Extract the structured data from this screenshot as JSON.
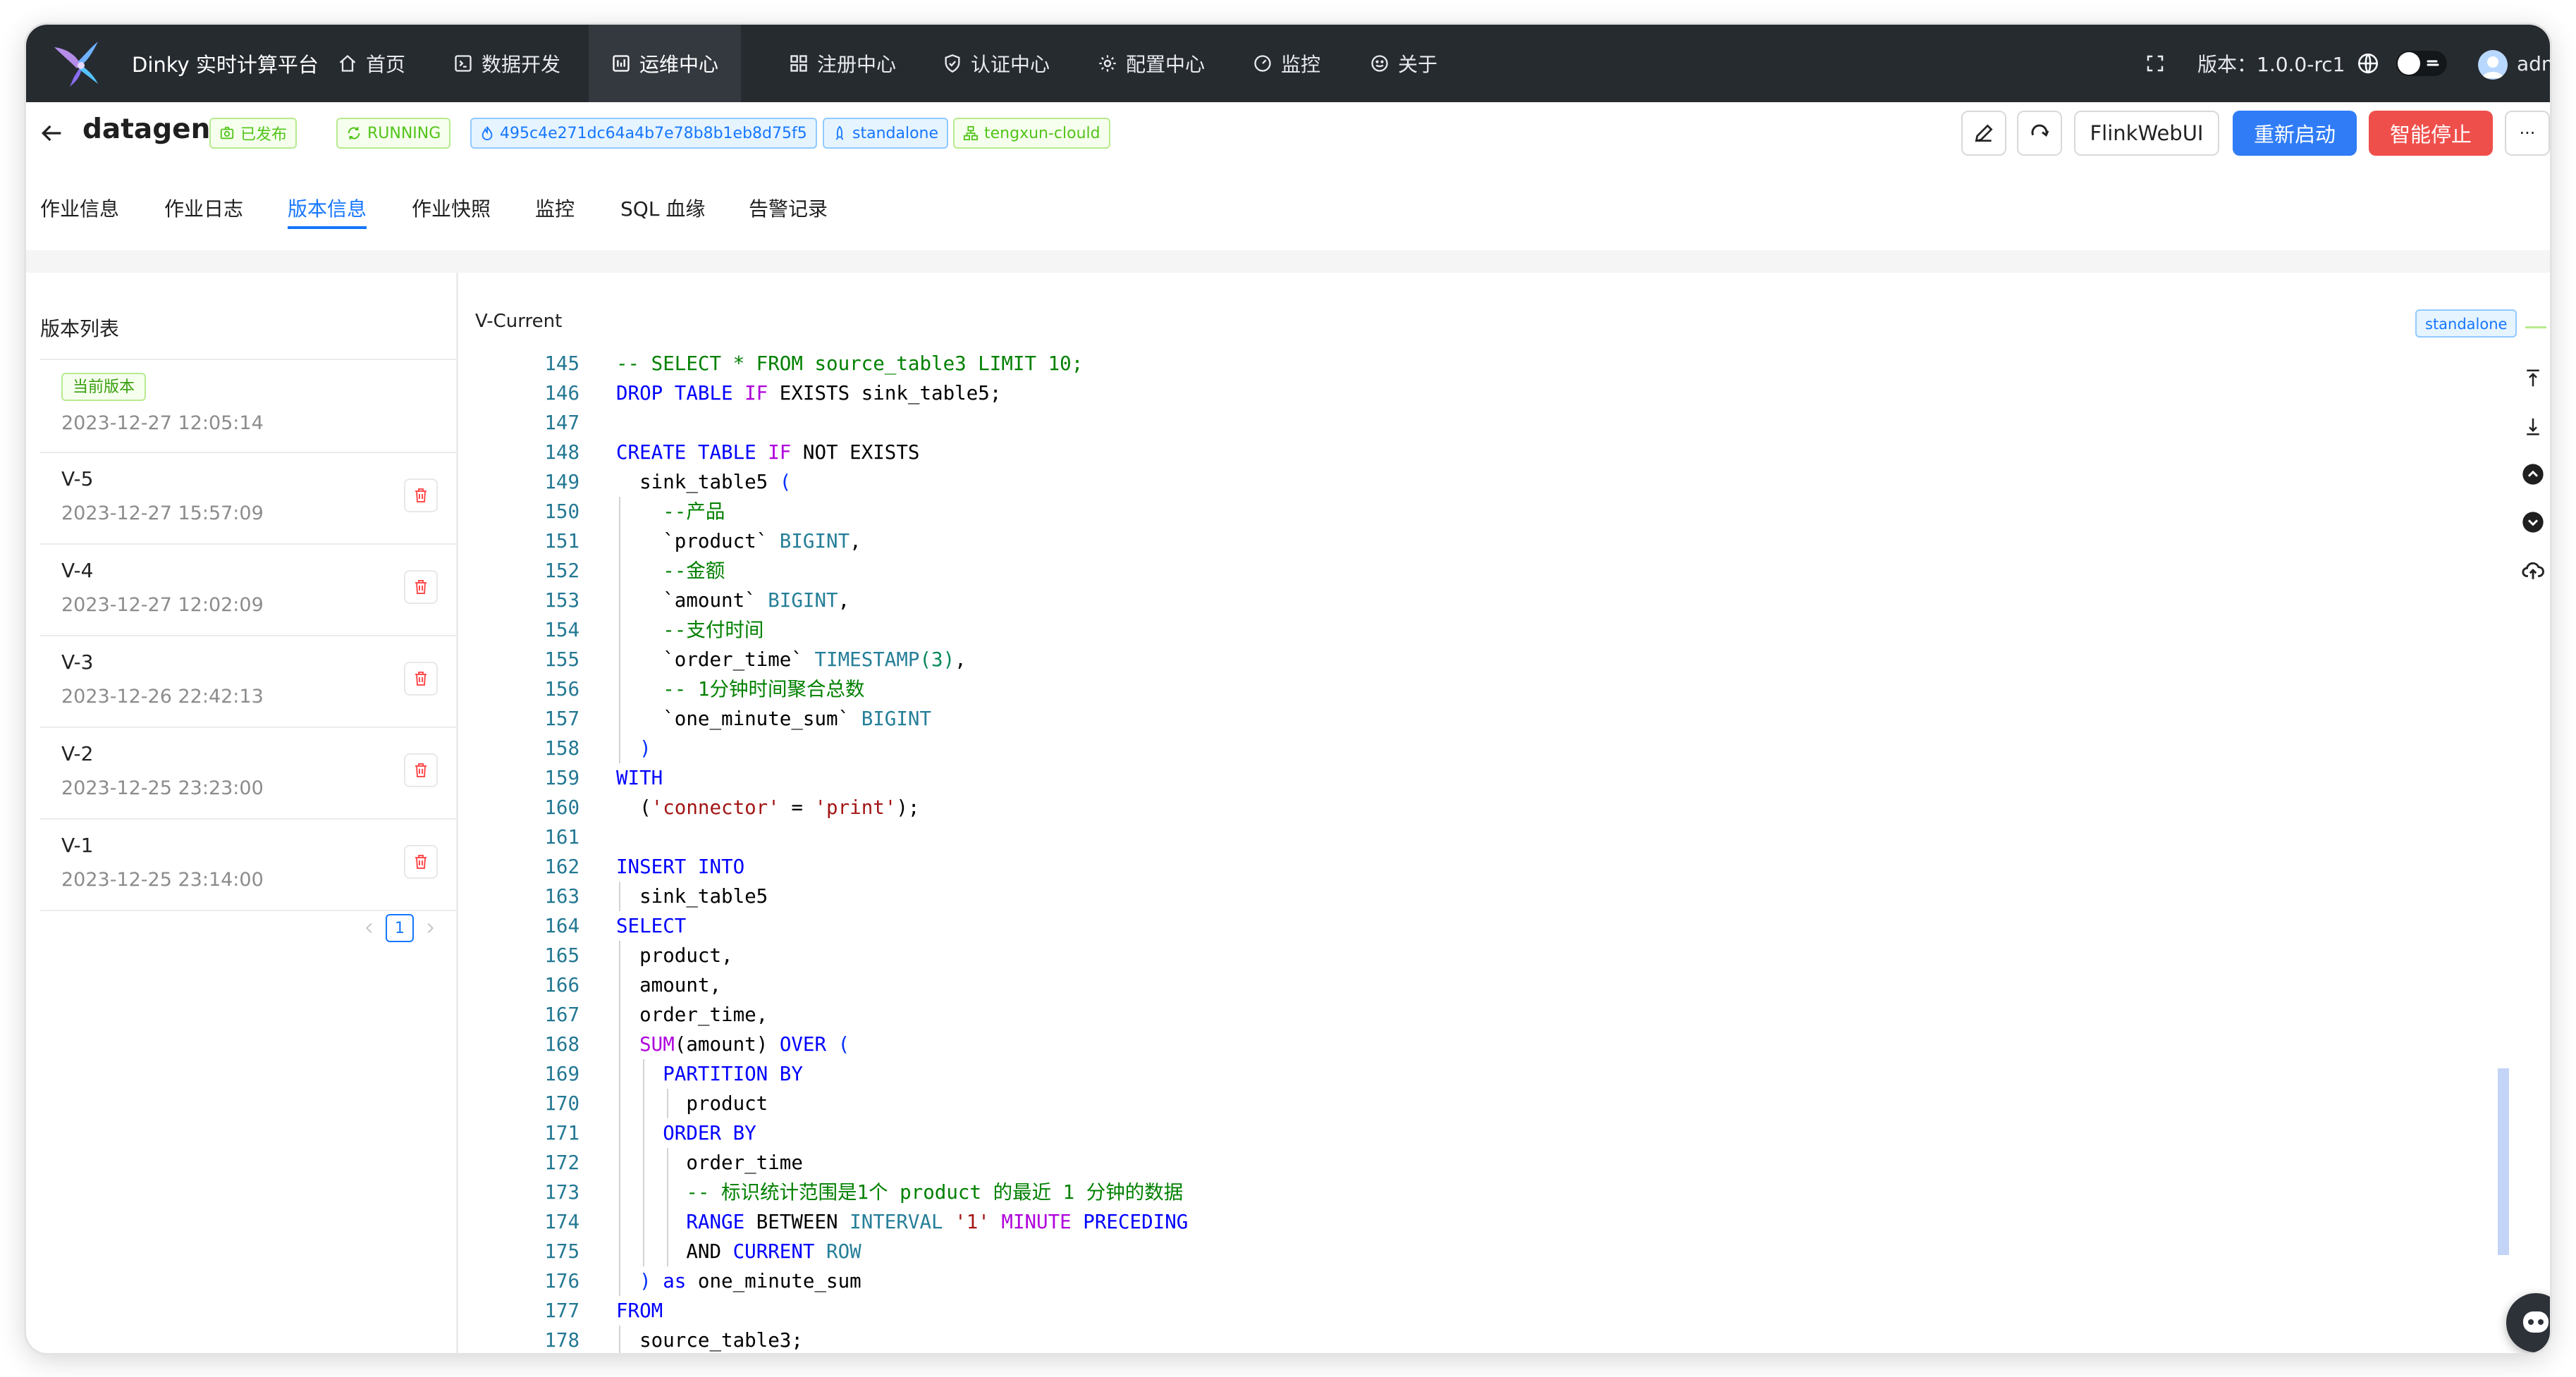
{
  "topbar": {
    "app_title": "Dinky 实时计算平台",
    "nav": [
      {
        "label": "首页",
        "icon": "home-icon",
        "active": false
      },
      {
        "label": "数据开发",
        "icon": "code-icon",
        "active": false
      },
      {
        "label": "运维中心",
        "icon": "dashboard-icon",
        "active": true
      },
      {
        "label": "注册中心",
        "icon": "grid-icon",
        "active": false
      },
      {
        "label": "认证中心",
        "icon": "shield-icon",
        "active": false
      },
      {
        "label": "配置中心",
        "icon": "gear-icon",
        "active": false
      },
      {
        "label": "监控",
        "icon": "gauge-icon",
        "active": false
      },
      {
        "label": "关于",
        "icon": "smile-icon",
        "active": false
      }
    ],
    "version_text": "版本：1.0.0-rc1",
    "user_name": "admin",
    "colors": {
      "background": "#262b30",
      "active_background": "#34393f"
    }
  },
  "job": {
    "name": "datagen",
    "status_published": "已发布",
    "status_running": "RUNNING",
    "job_id": "495c4e271dc64a4b7e78b8b1eb8d75f5",
    "cluster_type": "standalone",
    "cluster_name": "tengxun-clould",
    "buttons": {
      "flink_web_ui": "FlinkWebUI",
      "restart": "重新启动",
      "smart_stop": "智能停止",
      "more": "···"
    },
    "colors": {
      "restart": "#2f7cf6",
      "smart_stop": "#ef4f4b",
      "success": "#52c41a",
      "link": "#1677ff"
    }
  },
  "tabs": [
    {
      "label": "作业信息",
      "active": false
    },
    {
      "label": "作业日志",
      "active": false
    },
    {
      "label": "版本信息",
      "active": true
    },
    {
      "label": "作业快照",
      "active": false
    },
    {
      "label": "监控",
      "active": false
    },
    {
      "label": "SQL 血缘",
      "active": false
    },
    {
      "label": "告警记录",
      "active": false
    }
  ],
  "version_list": {
    "title": "版本列表",
    "current_badge": "当前版本",
    "current_time": "2023-12-27 12:05:14",
    "items": [
      {
        "name": "V-5",
        "time": "2023-12-27 15:57:09"
      },
      {
        "name": "V-4",
        "time": "2023-12-27 12:02:09"
      },
      {
        "name": "V-3",
        "time": "2023-12-26 22:42:13"
      },
      {
        "name": "V-2",
        "time": "2023-12-25 23:23:00"
      },
      {
        "name": "V-1",
        "time": "2023-12-25 23:14:00"
      }
    ],
    "pagination": {
      "current_page": "1"
    }
  },
  "editor": {
    "title": "V-Current",
    "cluster_badge": "standalone",
    "scroll_position": 0.88,
    "first_line_number": 145,
    "lines": [
      [
        [
          "-- SELECT * FROM source_table3 LIMIT 10;",
          "c"
        ]
      ],
      [
        [
          "DROP TABLE ",
          "k"
        ],
        [
          "IF",
          "f"
        ],
        [
          " EXISTS sink_table5;",
          "p"
        ]
      ],
      [],
      [
        [
          "CREATE TABLE ",
          "k"
        ],
        [
          "IF",
          "f"
        ],
        [
          " NOT EXISTS",
          "p"
        ]
      ],
      [
        [
          "  sink_table5 ",
          "p"
        ],
        [
          "(",
          "b"
        ]
      ],
      [
        [
          "    --产品",
          "c"
        ]
      ],
      [
        [
          "    `product` ",
          "p"
        ],
        [
          "BIGINT",
          "y"
        ],
        [
          ",",
          "p"
        ]
      ],
      [
        [
          "    --金额",
          "c"
        ]
      ],
      [
        [
          "    `amount` ",
          "p"
        ],
        [
          "BIGINT",
          "y"
        ],
        [
          ",",
          "p"
        ]
      ],
      [
        [
          "    --支付时间",
          "c"
        ]
      ],
      [
        [
          "    `order_time` ",
          "p"
        ],
        [
          "TIMESTAMP",
          "y"
        ],
        [
          "(3)",
          "d"
        ],
        [
          ",",
          "p"
        ]
      ],
      [
        [
          "    -- 1分钟时间聚合总数",
          "c"
        ]
      ],
      [
        [
          "    `one_minute_sum` ",
          "p"
        ],
        [
          "BIGINT",
          "y"
        ]
      ],
      [
        [
          "  ",
          "p"
        ],
        [
          ")",
          "b"
        ]
      ],
      [
        [
          "WITH",
          "k"
        ]
      ],
      [
        [
          "  (",
          "p"
        ],
        [
          "'connector'",
          "s"
        ],
        [
          " = ",
          "p"
        ],
        [
          "'print'",
          "s"
        ],
        [
          ");",
          "p"
        ]
      ],
      [],
      [
        [
          "INSERT INTO",
          "k"
        ]
      ],
      [
        [
          "  sink_table5",
          "p"
        ]
      ],
      [
        [
          "SELECT",
          "k"
        ]
      ],
      [
        [
          "  product,",
          "p"
        ]
      ],
      [
        [
          "  amount,",
          "p"
        ]
      ],
      [
        [
          "  order_time,",
          "p"
        ]
      ],
      [
        [
          "  ",
          "p"
        ],
        [
          "SUM",
          "f"
        ],
        [
          "(amount) ",
          "p"
        ],
        [
          "OVER",
          "k"
        ],
        [
          " (",
          "b"
        ]
      ],
      [
        [
          "    PARTITION BY",
          "k"
        ]
      ],
      [
        [
          "      product",
          "p"
        ]
      ],
      [
        [
          "    ORDER BY",
          "k"
        ]
      ],
      [
        [
          "      order_time",
          "p"
        ]
      ],
      [
        [
          "      -- 标识统计范围是1个 product 的最近 1 分钟的数据",
          "c"
        ]
      ],
      [
        [
          "      RANGE ",
          "k"
        ],
        [
          "BETWEEN ",
          "p"
        ],
        [
          "INTERVAL ",
          "y"
        ],
        [
          "'1' ",
          "s"
        ],
        [
          "MINUTE ",
          "f"
        ],
        [
          "PRECEDING",
          "k"
        ]
      ],
      [
        [
          "      AND ",
          "p"
        ],
        [
          "CURRENT ",
          "k"
        ],
        [
          "ROW",
          "y"
        ]
      ],
      [
        [
          "  ",
          "p"
        ],
        [
          ")",
          "b"
        ],
        [
          " as ",
          "k"
        ],
        [
          "one_minute_sum",
          "p"
        ]
      ],
      [
        [
          "FROM",
          "k"
        ]
      ],
      [
        [
          "  source_table3;",
          "p"
        ]
      ]
    ],
    "indent_guides": [
      [],
      [],
      [],
      [],
      [],
      [
        1
      ],
      [
        1
      ],
      [
        1
      ],
      [
        1
      ],
      [
        1
      ],
      [
        1
      ],
      [
        1
      ],
      [
        1
      ],
      [
        1
      ],
      [],
      [],
      [],
      [],
      [
        1
      ],
      [],
      [
        1
      ],
      [
        1
      ],
      [
        1
      ],
      [
        1
      ],
      [
        1,
        2
      ],
      [
        1,
        2,
        3
      ],
      [
        1,
        2
      ],
      [
        1,
        2,
        3
      ],
      [
        1,
        2,
        3
      ],
      [
        1,
        2,
        3
      ],
      [
        1,
        2,
        3
      ],
      [
        1
      ],
      [],
      [
        1
      ]
    ]
  }
}
